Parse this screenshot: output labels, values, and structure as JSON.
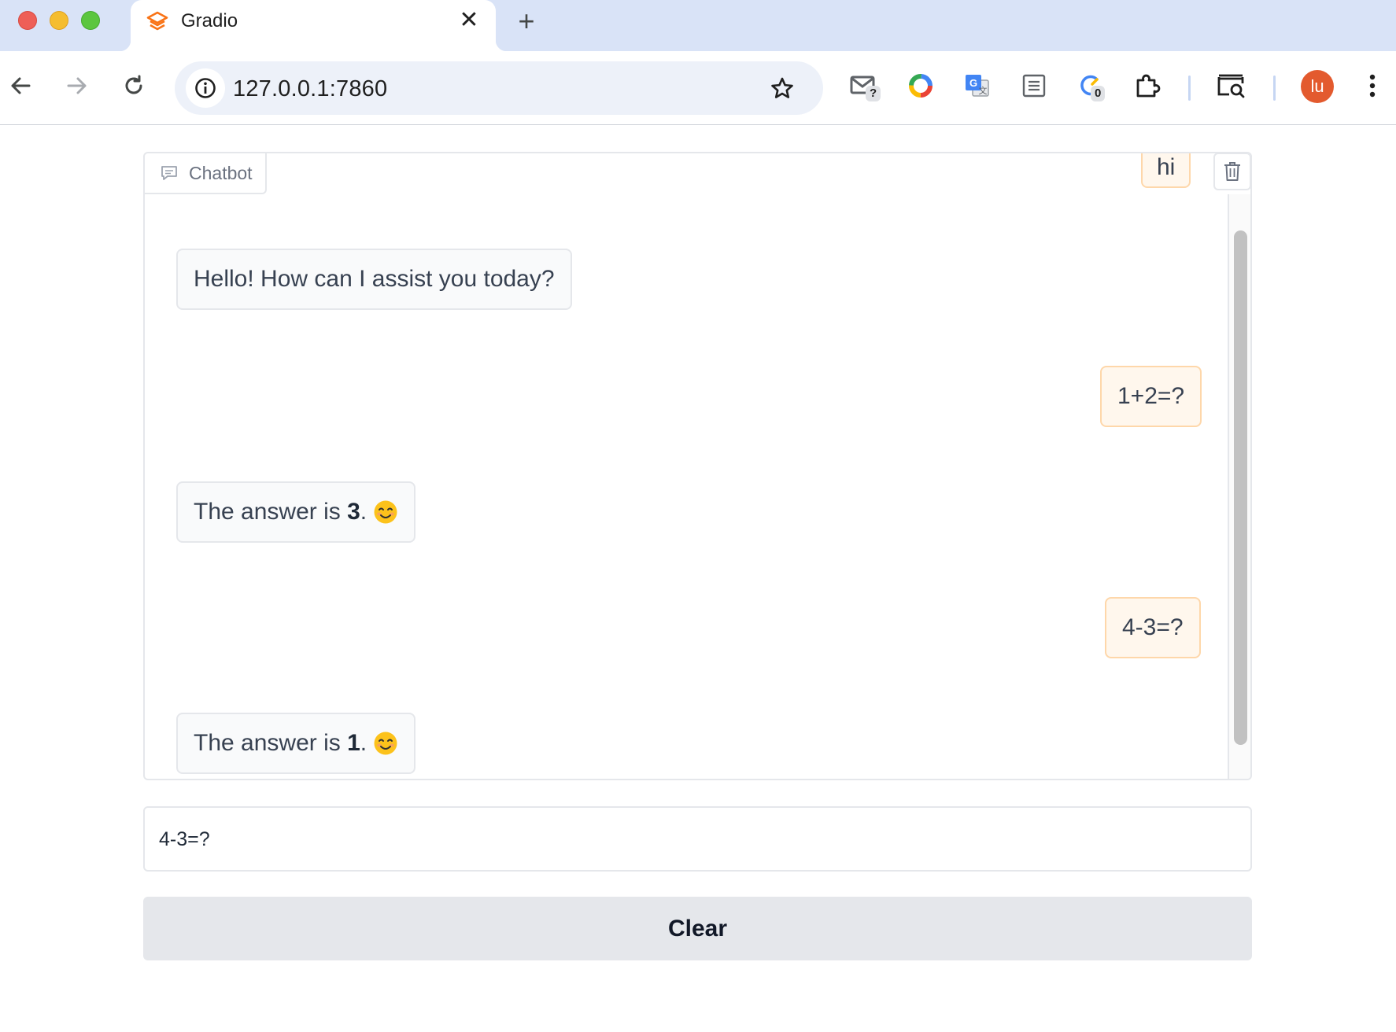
{
  "browser": {
    "tab_title": "Gradio",
    "tab_close_glyph": "✕",
    "new_tab_glyph": "+",
    "url": "127.0.0.1:7860",
    "avatar_initials": "lu",
    "avatar_color": "#e35a2e",
    "extensions": [
      {
        "name": "gmail-checker-icon",
        "badge": "?"
      },
      {
        "name": "colorful-ring-icon"
      },
      {
        "name": "google-translate-icon"
      },
      {
        "name": "reader-mode-icon"
      },
      {
        "name": "loading-spinner-icon",
        "badge": "0"
      },
      {
        "name": "extensions-puzzle-icon"
      },
      {
        "name": "tab-search-icon"
      }
    ]
  },
  "chatbot": {
    "label": "Chatbot",
    "messages": [
      {
        "role": "user",
        "text": "hi"
      },
      {
        "role": "bot",
        "text": "Hello! How can I assist you today?"
      },
      {
        "role": "user",
        "text": "1+2=?"
      },
      {
        "role": "bot",
        "text_before": "The answer is ",
        "bold": "3",
        "text_after": ".",
        "emoji": "smiling-face-emoji"
      },
      {
        "role": "user",
        "text": "4-3=?"
      },
      {
        "role": "bot",
        "text_before": "The answer is ",
        "bold": "1",
        "text_after": ".",
        "emoji": "smiling-face-emoji"
      }
    ]
  },
  "input": {
    "value": "4-3=?"
  },
  "clear_button": {
    "label": "Clear"
  },
  "colors": {
    "tabstrip_bg": "#d9e3f7",
    "user_bubble_bg": "#fff7ed",
    "user_bubble_border": "#fed7aa",
    "bot_bubble_bg": "#f9fafb",
    "button_bg": "#e5e7eb",
    "gradio_orange": "#f97316"
  }
}
